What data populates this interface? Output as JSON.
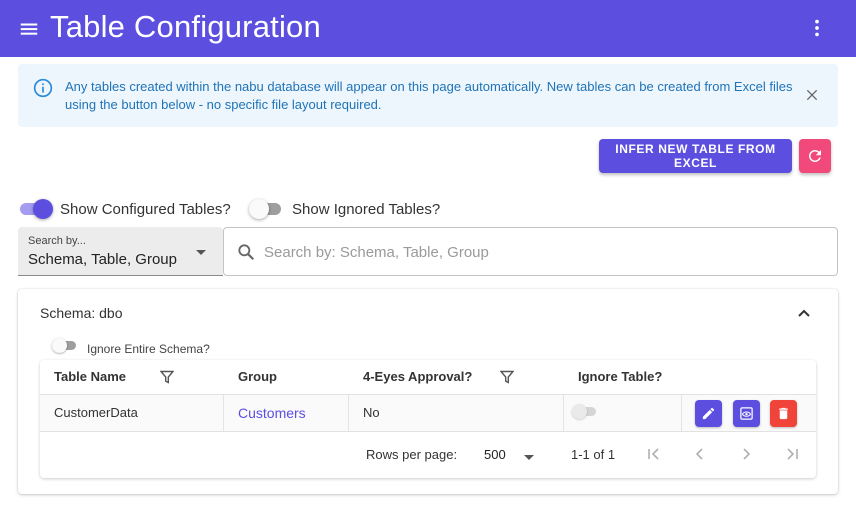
{
  "appbar": {
    "title": "Table Configuration"
  },
  "alert": {
    "message": "Any tables created within the nabu database will appear on this page automatically. New tables can be created from Excel files using the button below - no specific file layout required."
  },
  "actions": {
    "infer_label": "INFER NEW TABLE FROM EXCEL"
  },
  "toggles": {
    "configured": {
      "label": "Show Configured Tables?",
      "on": true
    },
    "ignored": {
      "label": "Show Ignored Tables?",
      "on": false
    }
  },
  "search": {
    "by_label": "Search by...",
    "by_value": "Schema, Table, Group",
    "placeholder": "Search by: Schema, Table, Group"
  },
  "schema": {
    "title": "Schema: dbo",
    "ignore_label": "Ignore Entire Schema?",
    "ignore_on": false,
    "columns": [
      "Table Name",
      "Group",
      "4-Eyes Approval?",
      "Ignore Table?"
    ],
    "rows": [
      {
        "table_name": "CustomerData",
        "group": "Customers",
        "four_eyes": "No",
        "ignore": false
      }
    ],
    "pagination": {
      "rows_per_page_label": "Rows per page:",
      "rows_per_page": "500",
      "range": "1-1 of 1"
    }
  },
  "colors": {
    "primary": "#5c4fe0",
    "accent": "#f0497a",
    "danger": "#f0433a",
    "info_bg": "#eef6fd",
    "info_text": "#1f73b7"
  }
}
